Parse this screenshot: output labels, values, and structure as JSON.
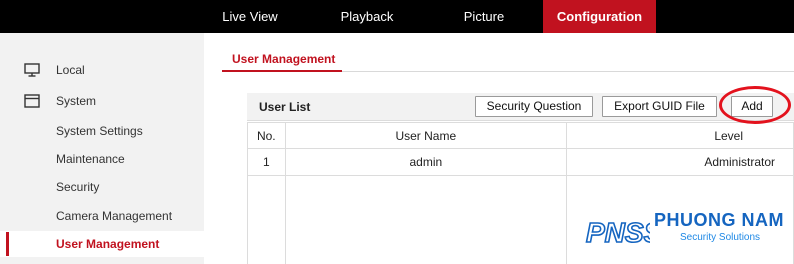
{
  "nav": {
    "items": [
      {
        "label": "Live View"
      },
      {
        "label": "Playback"
      },
      {
        "label": "Picture"
      },
      {
        "label": "Configuration",
        "active": true
      }
    ]
  },
  "sidebar": {
    "groups": [
      {
        "label": "Local",
        "icon": "monitor-icon"
      },
      {
        "label": "System",
        "icon": "window-icon"
      }
    ],
    "sub_items": [
      {
        "label": "System Settings"
      },
      {
        "label": "Maintenance"
      },
      {
        "label": "Security"
      },
      {
        "label": "Camera Management"
      },
      {
        "label": "User Management",
        "active": true
      }
    ]
  },
  "tab": {
    "label": "User Management"
  },
  "user_list": {
    "title": "User List",
    "buttons": {
      "security_question": "Security Question",
      "export_guid": "Export GUID File",
      "add": "Add"
    },
    "columns": [
      "No.",
      "User Name",
      "Level"
    ],
    "rows": [
      {
        "no": "1",
        "user_name": "admin",
        "level": "Administrator"
      }
    ]
  },
  "watermark": {
    "brand": "PHUONG NAM",
    "tagline": "Security Solutions",
    "mark": "PNSS"
  },
  "colors": {
    "accent": "#c1121f",
    "topbar": "#000000",
    "sidebar_bg": "#f2f2f2",
    "annotation": "#e3121d",
    "logo_blue": "#1565c0"
  }
}
